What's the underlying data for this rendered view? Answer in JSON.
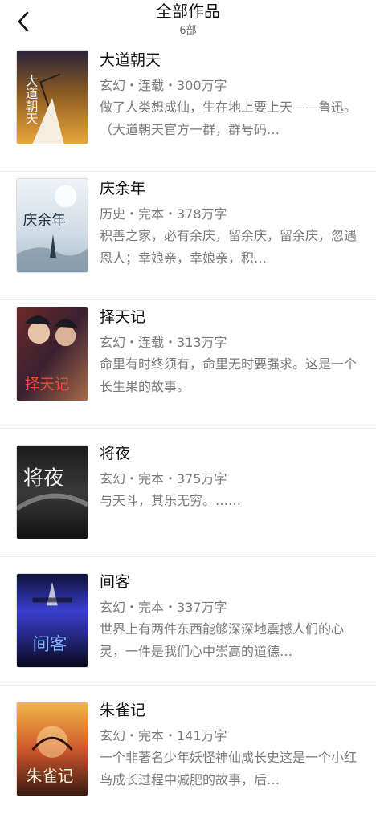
{
  "header": {
    "title": "全部作品",
    "count": "6部",
    "back_icon": "chevron-left-icon"
  },
  "books": [
    {
      "title": "大道朝天",
      "meta": "玄幻・连载・300万字",
      "desc": "做了人类想成仙，生在地上要上天——鲁迅。（大道朝天官方一群，群号码…",
      "cover_title": "大道朝天"
    },
    {
      "title": "庆余年",
      "meta": "历史・完本・378万字",
      "desc": "积善之家，必有余庆，留余庆，留余庆，忽遇恩人；幸娘亲，幸娘亲，积…",
      "cover_title": "庆余年"
    },
    {
      "title": "择天记",
      "meta": "玄幻・连载・313万字",
      "desc": "命里有时终须有，命里无时要强求。这是一个长生果的故事。",
      "cover_title": "择天记"
    },
    {
      "title": "将夜",
      "meta": "玄幻・完本・375万字",
      "desc": "与天斗，其乐无穷。……",
      "cover_title": "将夜"
    },
    {
      "title": "间客",
      "meta": "玄幻・完本・337万字",
      "desc": "世界上有两件东西能够深深地震撼人们的心灵，一件是我们心中崇高的道德…",
      "cover_title": "间客"
    },
    {
      "title": "朱雀记",
      "meta": "玄幻・完本・141万字",
      "desc": "一个非著名少年妖怪神仙成长史这是一个小红鸟成长过程中减肥的故事，后…",
      "cover_title": "朱雀记"
    }
  ]
}
